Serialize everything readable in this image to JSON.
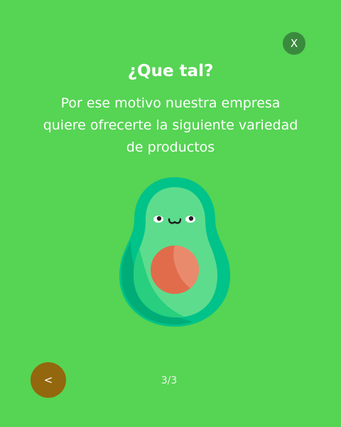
{
  "dialog": {
    "close_label": "X",
    "title": "¿Que tal?",
    "message": "Por ese motivo nuestra empresa quiere ofrecerte la siguiente variedad de productos",
    "illustration_icon": "avocado-icon"
  },
  "footer": {
    "back_label": "<",
    "pager": "3/3"
  },
  "colors": {
    "background": "#56d454",
    "close_button": "#3a8a3e",
    "back_button": "#93670d",
    "avocado_skin": "#00c389",
    "avocado_flesh": "#5ddc8e",
    "avocado_pit": "#e16c4b"
  }
}
